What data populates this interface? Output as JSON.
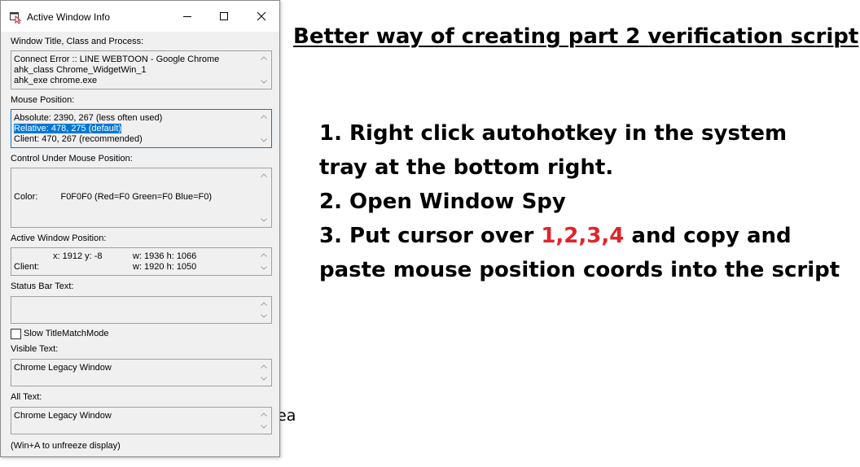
{
  "window": {
    "title": "Active Window Info",
    "minimize_icon": "minimize-icon",
    "maximize_icon": "maximize-icon",
    "close_icon": "close-icon"
  },
  "sections": {
    "title_class_process": {
      "label": "Window Title, Class and Process:",
      "lines": [
        "Connect Error :: LINE WEBTOON - Google Chrome",
        "ahk_class Chrome_WidgetWin_1",
        "ahk_exe chrome.exe"
      ]
    },
    "mouse_position": {
      "label": "Mouse Position:",
      "absolute": "Absolute:  2390, 267 (less often used)",
      "relative": "Relative:  478, 275 (default)",
      "client": "Client:       470, 267 (recommended)"
    },
    "control_under_mouse": {
      "label": "Control Under Mouse Position:",
      "color_label": "Color:",
      "color_value": "F0F0F0 (Red=F0 Green=F0 Blue=F0)"
    },
    "active_window_position": {
      "label": "Active Window Position:",
      "row1": {
        "pos": "x: 1912   y: -8",
        "size": "w: 1936   h: 1066"
      },
      "row2": {
        "label": "Client:",
        "size": "w: 1920   h: 1050"
      }
    },
    "status_bar": {
      "label": "Status Bar Text:"
    },
    "slow_title_match": {
      "label": "Slow TitleMatchMode",
      "checked": false
    },
    "visible_text": {
      "label": "Visible Text:",
      "value": "Chrome Legacy Window"
    },
    "all_text": {
      "label": "All Text:",
      "value": "Chrome Legacy Window"
    },
    "footer": "(Win+A to unfreeze display)"
  },
  "slide": {
    "title": "Better way of creating part 2 verification script",
    "step1a": "1. Right click autohotkey in the system",
    "step1b": "tray at the bottom right.",
    "step2": "2. Open Window Spy",
    "step3_prefix": "3. Put cursor over ",
    "step3_highlight": "1,2,3,4",
    "step3_suffix": " and copy and",
    "step3b": "paste mouse position coords into the script",
    "partial_text": "ea"
  },
  "colors": {
    "highlight": "#0078d7",
    "accent_red": "#e2232a"
  }
}
